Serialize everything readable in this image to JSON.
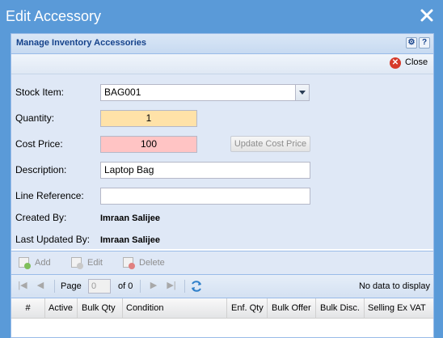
{
  "window": {
    "title": "Edit Accessory"
  },
  "panel": {
    "title": "Manage Inventory Accessories"
  },
  "close_bar": {
    "close_label": "Close"
  },
  "form": {
    "stock_item_label": "Stock Item:",
    "stock_item_value": "BAG001",
    "quantity_label": "Quantity:",
    "quantity_value": "1",
    "cost_price_label": "Cost Price:",
    "cost_price_value": "100",
    "update_cost_price_label": "Update Cost Price",
    "description_label": "Description:",
    "description_value": "Laptop Bag",
    "line_reference_label": "Line Reference:",
    "line_reference_value": "",
    "created_by_label": "Created By:",
    "created_by_value": "Imraan Salijee",
    "last_updated_by_label": "Last Updated By:",
    "last_updated_by_value": "Imraan Salijee"
  },
  "actions": {
    "add": "Add",
    "edit": "Edit",
    "delete": "Delete"
  },
  "pager": {
    "page_label": "Page",
    "page_value": "0",
    "of_label": "of 0",
    "empty_text": "No data to display"
  },
  "grid": {
    "columns": [
      "#",
      "Active",
      "Bulk Qty",
      "Condition",
      "Enf. Qty",
      "Bulk Offer",
      "Bulk Disc.",
      "Selling Ex VAT"
    ]
  },
  "colors": {
    "title_bar": "#5a9ad8",
    "quantity_bg": "#ffe2a8",
    "cost_price_bg": "#ffc4c4",
    "close_icon": "#d63a2a"
  }
}
